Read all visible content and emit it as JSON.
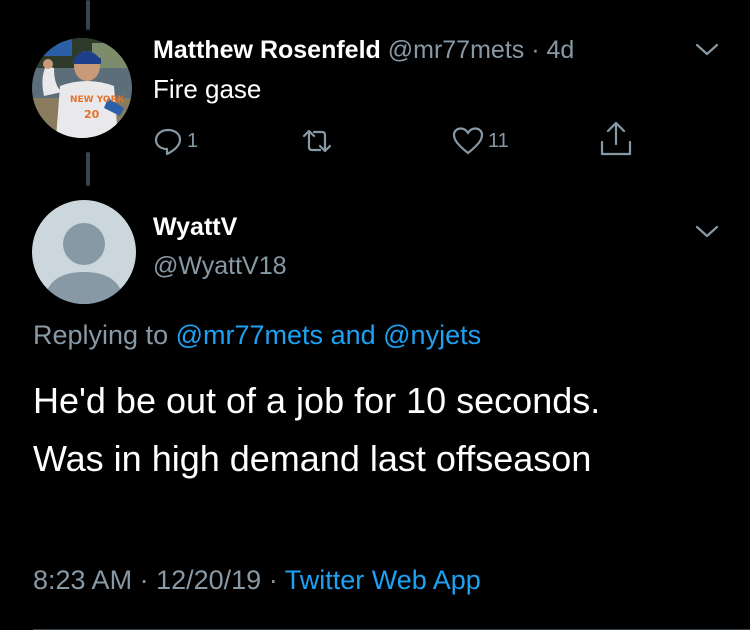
{
  "parent_tweet": {
    "name": "Matthew Rosenfeld",
    "handle": "@mr77mets",
    "time": "4d",
    "separator": "·",
    "text": "Fire gase",
    "reply_count": "1",
    "like_count": "11",
    "avatar_jersey_text": "NEW YORK",
    "avatar_jersey_number": "20"
  },
  "main_tweet": {
    "name": "WyattV",
    "handle": "@WyattV18",
    "replying_prefix": "Replying to",
    "replying_user1": "@mr77mets",
    "replying_and": "and",
    "replying_user2": "@nyjets",
    "text_line1": "He'd be out of a job for 10 seconds.",
    "text_line2": "Was in high demand last offseason",
    "time": "8:23 AM",
    "date": "12/20/19",
    "separator": "·",
    "source": "Twitter Web App"
  },
  "colors": {
    "background": "#000000",
    "primary_text": "#ffffff",
    "secondary_text": "#8899a6",
    "link": "#1da1f2",
    "thread_line": "#38444d",
    "default_avatar": "#ccd6dd"
  },
  "icons": [
    "reply-icon",
    "retweet-icon",
    "like-icon",
    "share-icon",
    "chevron-down-icon"
  ]
}
